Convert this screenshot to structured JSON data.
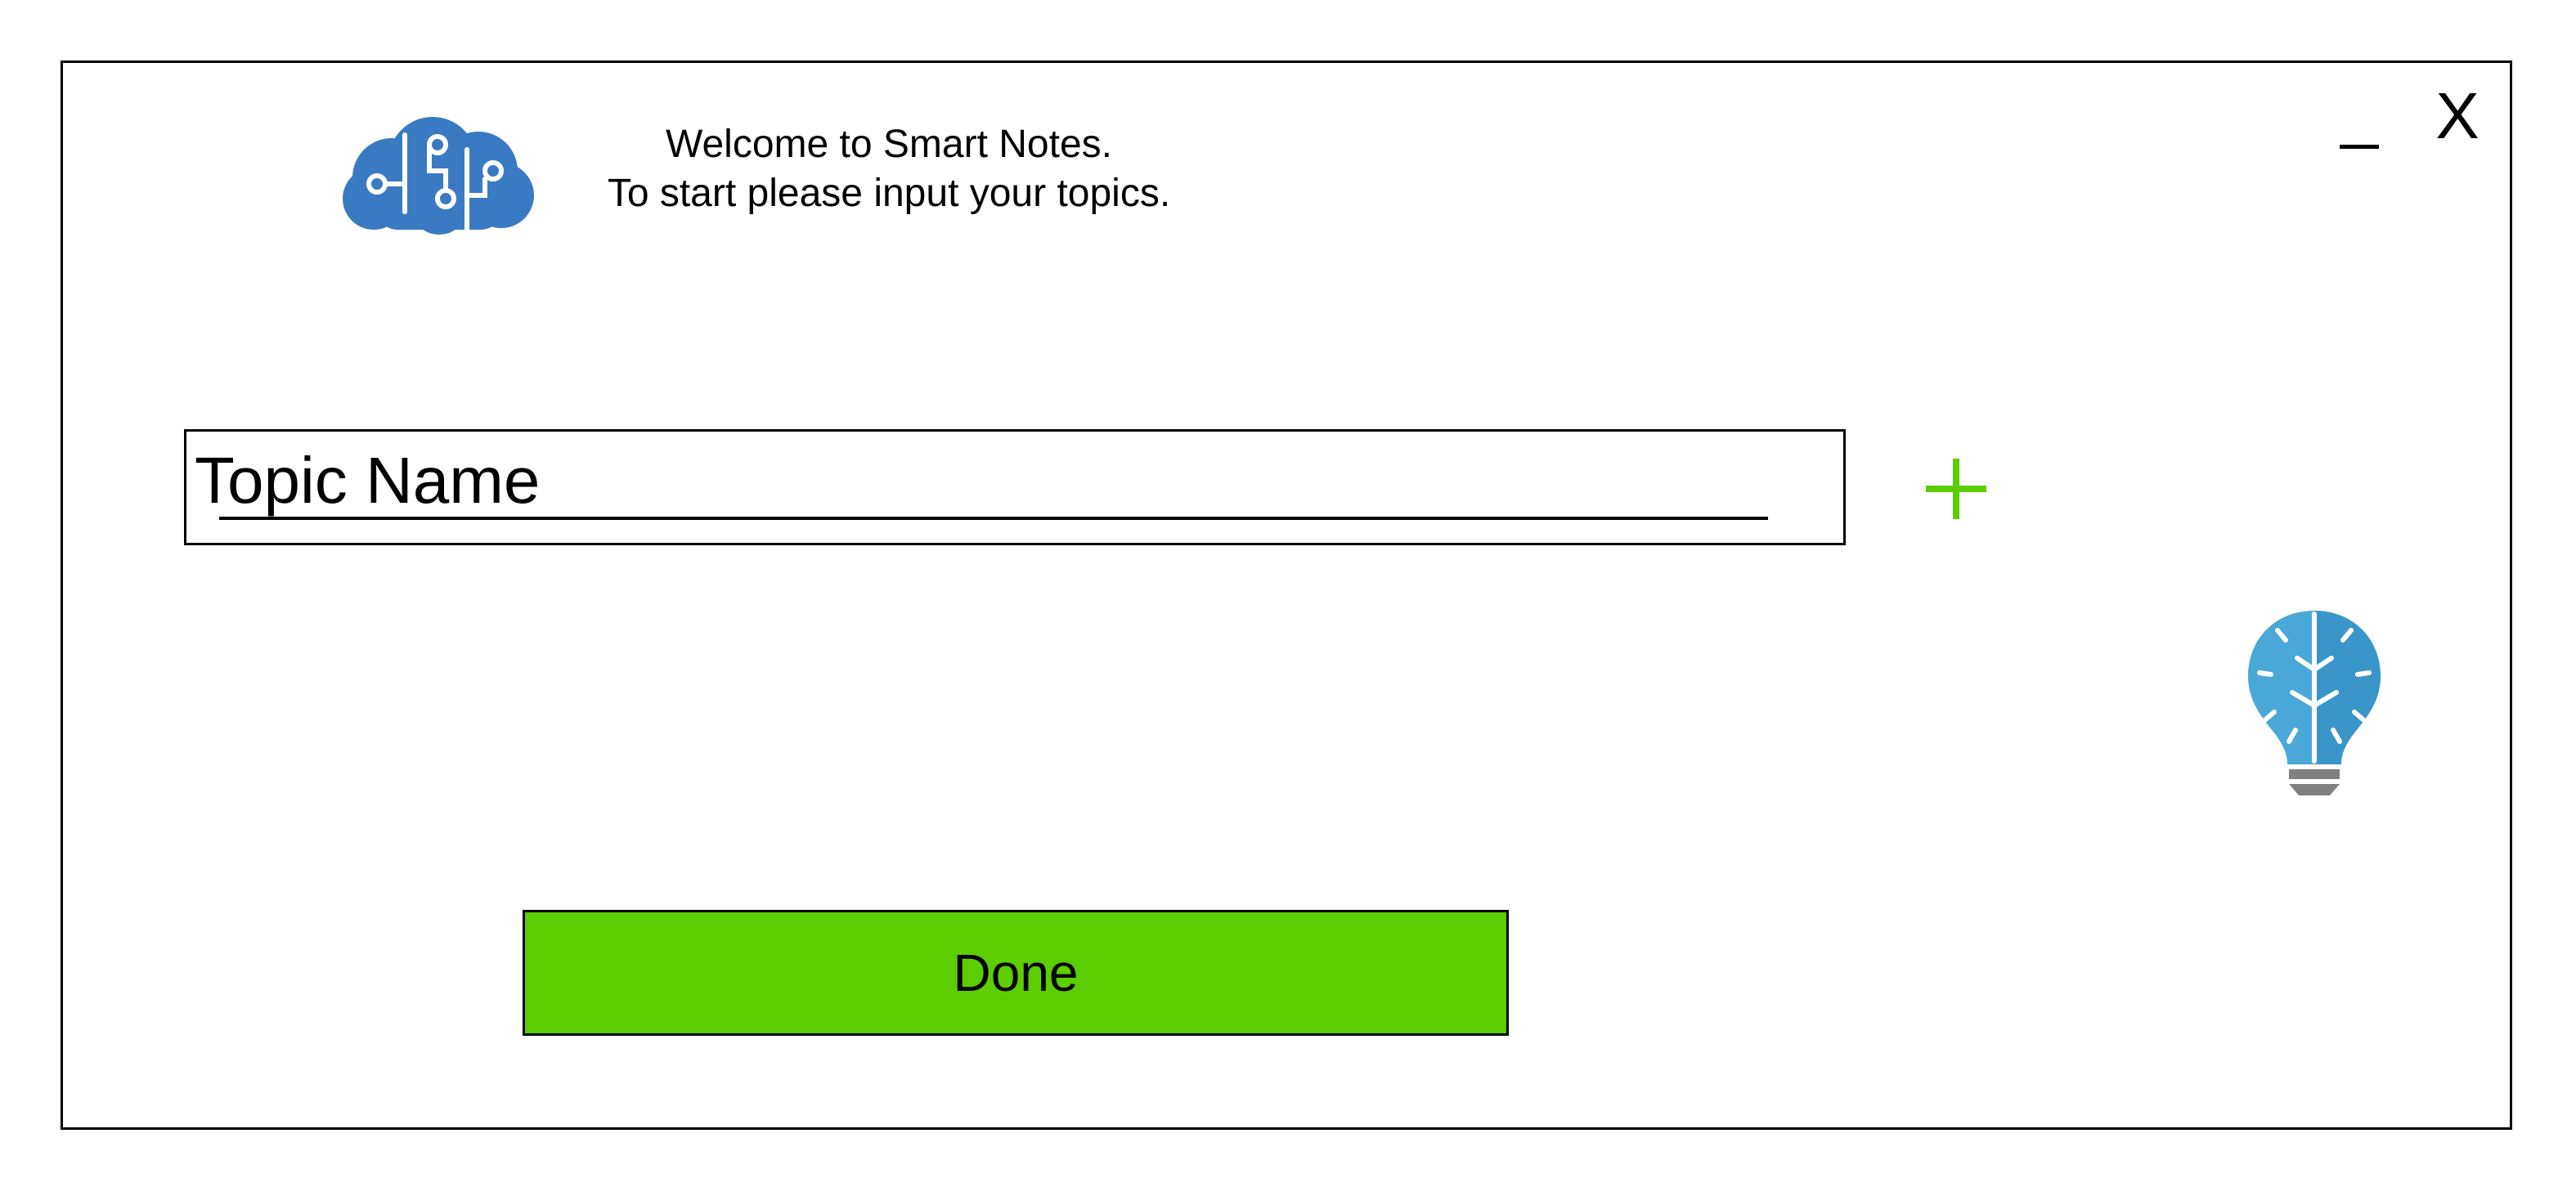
{
  "window": {
    "welcome_line1": "Welcome to Smart Notes.",
    "welcome_line2": "To start please input your topics.",
    "close_label": "X",
    "minimize_label": "_"
  },
  "topic": {
    "placeholder": "Topic Name",
    "value": ""
  },
  "actions": {
    "done_label": "Done",
    "add_icon": "plus-icon"
  },
  "icons": {
    "logo": "brain-circuit-cloud-icon",
    "decoration": "lightbulb-brain-icon"
  },
  "colors": {
    "accent_green": "#5bcd00",
    "logo_blue": "#3a7ac3",
    "bulb_blue": "#4aa8d8",
    "bulb_base_gray": "#808080"
  }
}
